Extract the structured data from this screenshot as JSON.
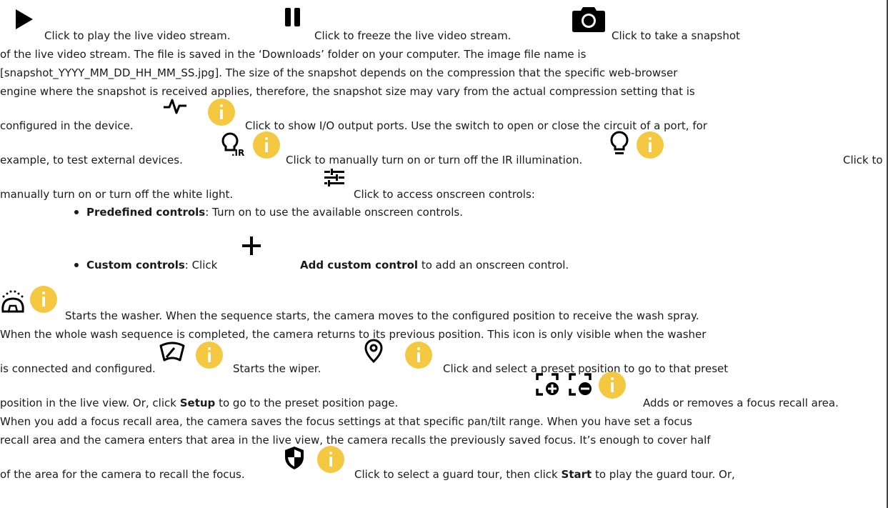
{
  "icons": {
    "play": "play-icon",
    "pause": "pause-icon",
    "snapshot": "camera-icon",
    "io": "io-pulse-icon",
    "ir": "ir-bulb-icon",
    "light": "light-bulb-icon",
    "controls": "sliders-icon",
    "add": "plus-icon",
    "washer": "washer-icon",
    "wiper": "wiper-icon",
    "preset": "location-pin-icon",
    "focus_add": "focus-add-icon",
    "focus_remove": "focus-remove-icon",
    "guard": "shield-icon",
    "info_color": "#f5c842"
  },
  "text": {
    "play_desc": "Click to play the live video stream.",
    "pause_desc": "Click to freeze the live video stream.",
    "snapshot_desc": "Click to take a snapshot",
    "snapshot_l2": "of the live video stream. The file is saved in the ‘Downloads’ folder on your computer. The image file name is",
    "snapshot_l3": "[snapshot_YYYY_MM_DD_HH_MM_SS.jpg]. The size of the snapshot depends on the compression that the specific web-browser",
    "snapshot_l4": "engine where the snapshot is received applies, therefore, the snapshot size may vary from the actual compression setting that is",
    "snapshot_l5": "configured in the device.",
    "io_desc": "Click to show I/O output ports. Use the switch to open or close the circuit of a port, for",
    "io_l2": "example, to test external devices.",
    "ir_desc": "Click to manually turn on or turn off the IR illumination.",
    "light_desc": "Click to",
    "light_l2": "manually turn on or turn off the white light.",
    "controls_desc": "Click to access onscreen controls:",
    "predef_label": "Predefined controls",
    "predef_desc": ": Turn on to use the available onscreen controls.",
    "custom_label": "Custom controls",
    "custom_desc": ": Click",
    "add_label": "Add custom control",
    "add_desc": "to add an onscreen control.",
    "washer_desc": "Starts the washer. When the sequence starts, the camera moves to the configured position to receive the wash spray.",
    "washer_l2": "When the whole wash sequence is completed, the camera returns to its previous position. This icon is only visible when the washer",
    "washer_l3": "is connected and configured.",
    "wiper_desc": "Starts the wiper.",
    "preset_desc": "Click and select a preset position to go to that preset",
    "preset_l2a": "position in the live view. Or, click",
    "setup_label": "Setup",
    "preset_l2b": "to go to the preset position page.",
    "focus_desc": "Adds or removes a focus recall area.",
    "focus_l2": "When you add a focus recall area, the camera saves the focus settings at that specific pan/tilt range. When you have set a focus",
    "focus_l3": "recall area and the camera enters that area in the live view, the camera recalls the previously saved focus. It’s enough to cover half",
    "focus_l4": "of the area for the camera to recall the focus.",
    "guard_desc_a": "Click to select a guard tour, then click",
    "start_label": "Start",
    "guard_desc_b": "to play the guard tour. Or,"
  }
}
